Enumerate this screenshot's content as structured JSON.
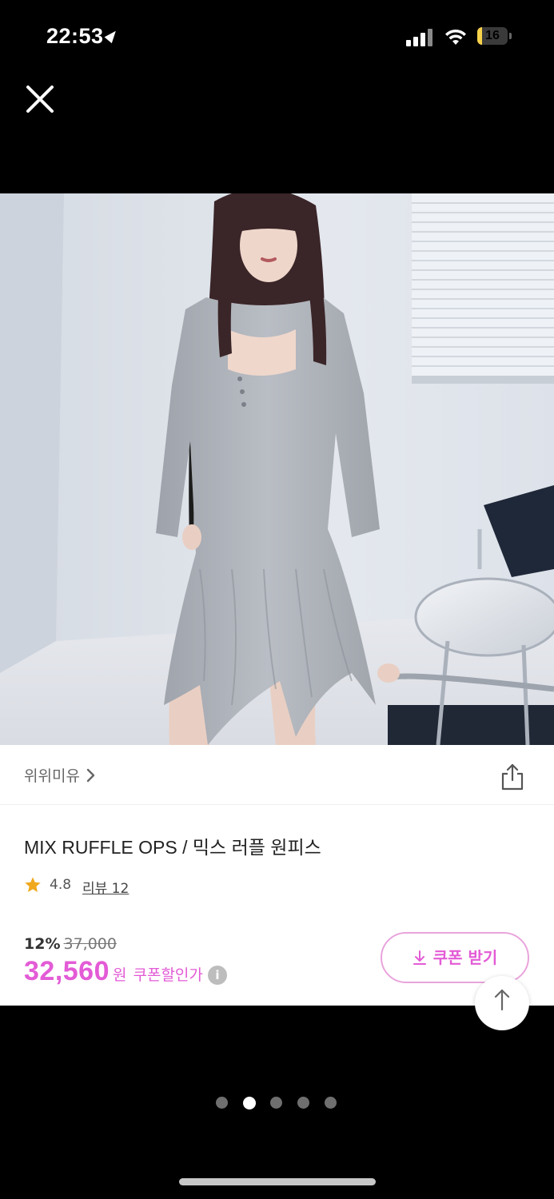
{
  "status_bar": {
    "time": "22:53",
    "battery_level": "16",
    "battery_fraction": 0.16
  },
  "brand": {
    "name": "위위미유"
  },
  "product": {
    "title": "MIX RUFFLE OPS / 믹스 러플 원피스",
    "rating": "4.8",
    "review_label": "리뷰 12",
    "discount_percent": "12%",
    "original_price": "37,000",
    "sale_price": "32,560",
    "currency_unit": "원",
    "coupon_discount_label": "쿠폰할인가",
    "info_glyph": "i"
  },
  "coupon_button": {
    "label": "쿠폰 받기"
  },
  "carousel": {
    "total_pages": 5,
    "active_index": 1
  },
  "colors": {
    "accent_pink": "#e35bd6",
    "coupon_border": "#e9a4dc",
    "star_gold": "#f0a81c",
    "background": "#000000",
    "card": "#ffffff"
  },
  "icons": {
    "close": "close-icon",
    "share": "share-icon",
    "star": "star-icon",
    "download": "download-icon",
    "scroll_top": "arrow-up-icon",
    "chevron": "chevron-right-icon"
  }
}
